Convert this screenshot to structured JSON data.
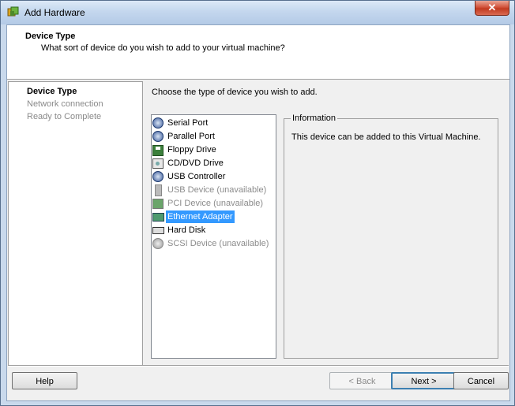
{
  "window": {
    "title": "Add Hardware",
    "close_label": "✕"
  },
  "header": {
    "title": "Device Type",
    "subtitle": "What sort of device do you wish to add to your virtual machine?"
  },
  "steps": [
    {
      "label": "Device Type",
      "active": true
    },
    {
      "label": "Network connection",
      "active": false
    },
    {
      "label": "Ready to Complete",
      "active": false
    }
  ],
  "prompt": "Choose the type of device you wish to add.",
  "devices": [
    {
      "label": "Serial Port",
      "icon": "serial-port-icon",
      "state": "enabled"
    },
    {
      "label": "Parallel Port",
      "icon": "parallel-port-icon",
      "state": "enabled"
    },
    {
      "label": "Floppy Drive",
      "icon": "floppy-drive-icon",
      "state": "enabled"
    },
    {
      "label": "CD/DVD Drive",
      "icon": "cd-dvd-drive-icon",
      "state": "enabled"
    },
    {
      "label": "USB Controller",
      "icon": "usb-controller-icon",
      "state": "enabled"
    },
    {
      "label": "USB Device (unavailable)",
      "icon": "usb-device-icon",
      "state": "disabled"
    },
    {
      "label": "PCI Device (unavailable)",
      "icon": "pci-device-icon",
      "state": "disabled"
    },
    {
      "label": "Ethernet Adapter",
      "icon": "ethernet-adapter-icon",
      "state": "selected"
    },
    {
      "label": "Hard Disk",
      "icon": "hard-disk-icon",
      "state": "enabled"
    },
    {
      "label": "SCSI Device (unavailable)",
      "icon": "scsi-device-icon",
      "state": "disabled"
    }
  ],
  "information": {
    "legend": "Information",
    "text": "This device can be added to this Virtual Machine."
  },
  "buttons": {
    "help": "Help",
    "back": "< Back",
    "next": "Next >",
    "cancel": "Cancel"
  },
  "colors": {
    "selection": "#3399ff",
    "disabled_text": "#8c8c8c"
  }
}
